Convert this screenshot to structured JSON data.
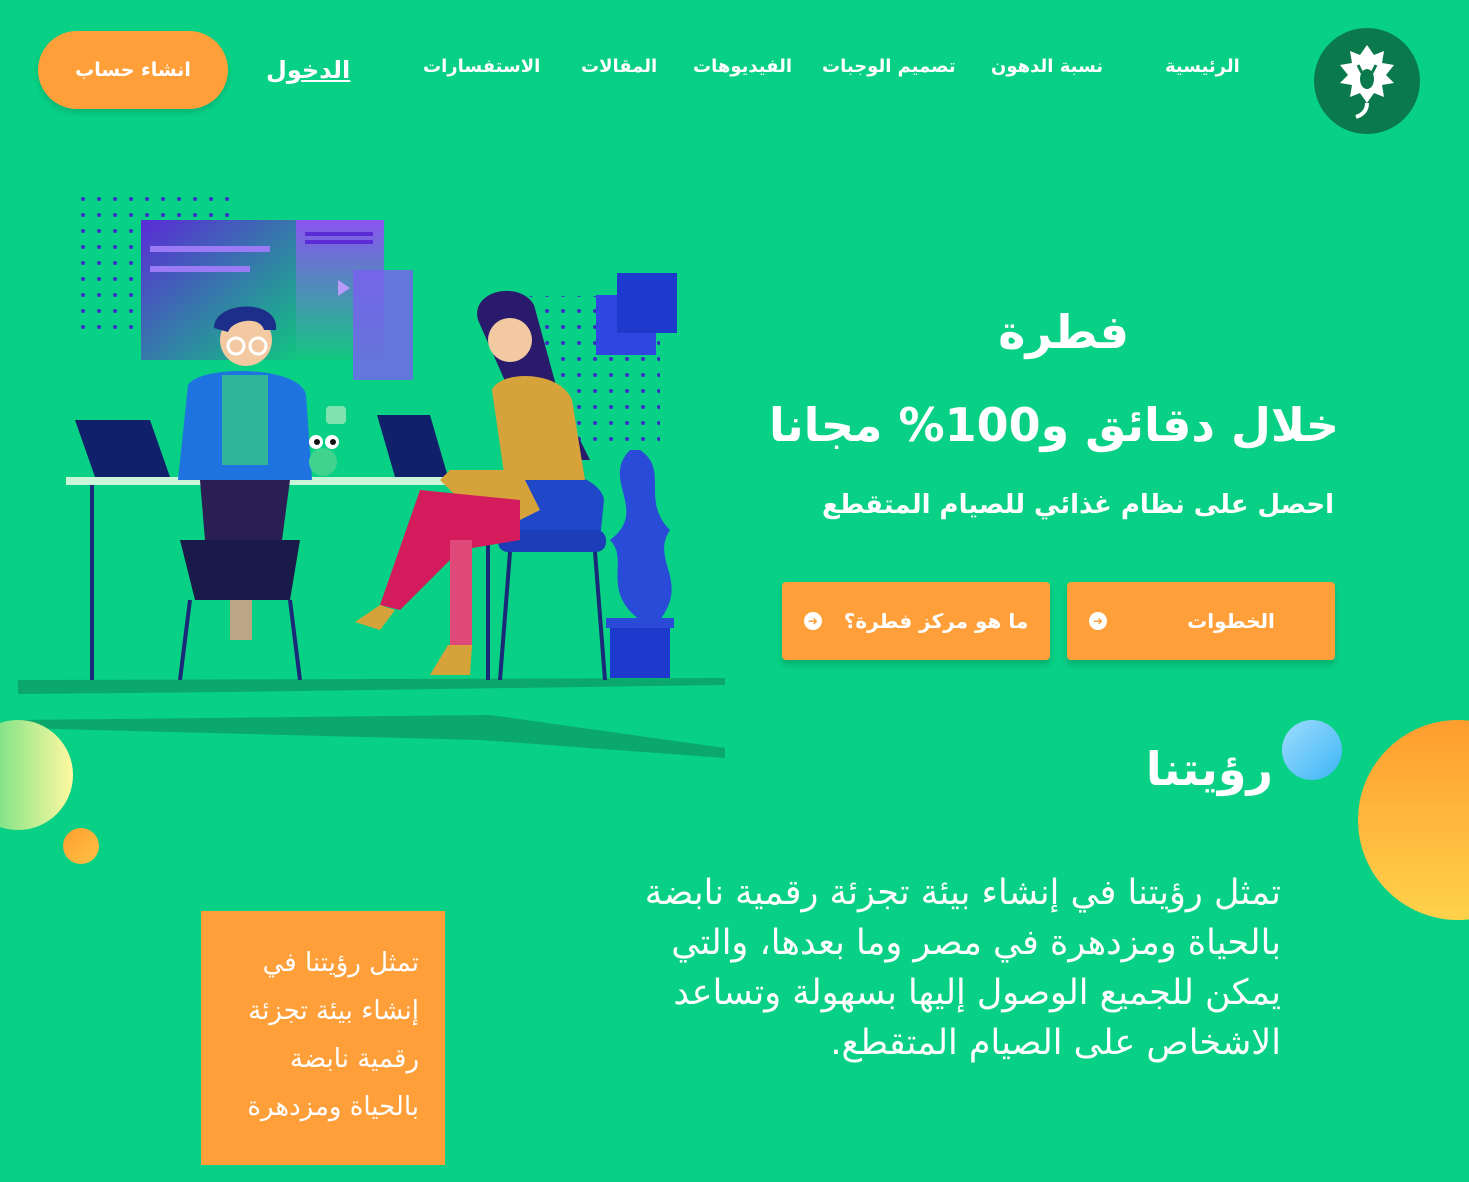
{
  "nav": {
    "items": [
      {
        "key": "home",
        "label": "الرئيسية"
      },
      {
        "key": "fat",
        "label": "نسبة الدهون"
      },
      {
        "key": "meals",
        "label": "تصميم الوجبات"
      },
      {
        "key": "videos",
        "label": "الفيديوهات"
      },
      {
        "key": "articles",
        "label": "المقالات"
      },
      {
        "key": "inquiries",
        "label": "الاستفسارات"
      }
    ],
    "login": "الدخول",
    "signup": "انشاء حساب"
  },
  "hero": {
    "title": "فطرة",
    "subtitle": "خلال دقائق و100% مجانا",
    "description": "احصل على نظام غذائي للصيام المتقطع",
    "buttons": {
      "steps": "الخطوات",
      "about": "ما هو مركز فطرة؟"
    }
  },
  "vision": {
    "title": "رؤيتنا",
    "text": "تمثل رؤيتنا في إنشاء بيئة تجزئة رقمية نابضة بالحياة ومزدهرة في مصر وما بعدها، والتي يمكن للجميع الوصول إليها بسهولة وتساعد الاشخاص على الصيام المتقطع.",
    "card_text": "تمثل رؤيتنا في إنشاء بيئة تجزئة رقمية نابضة بالحياة ومزدهرة"
  },
  "colors": {
    "background": "#08d085",
    "accent": "#ff9f3a",
    "logo_bg": "#0a7a4c"
  },
  "icons": {
    "logo": "deer-leaf-logo-icon",
    "button_arrow": "arrow-left-circle-icon"
  }
}
